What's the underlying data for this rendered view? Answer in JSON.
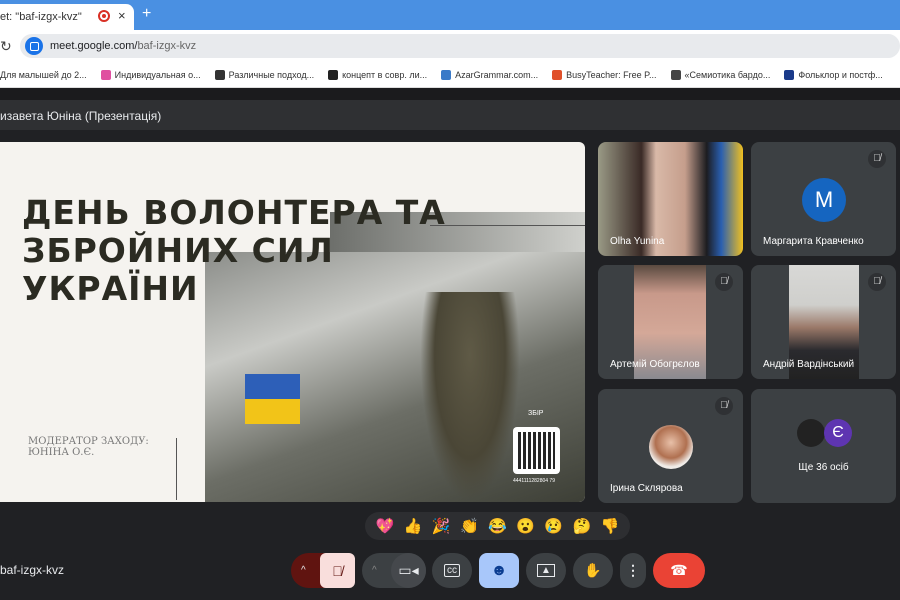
{
  "browser": {
    "tab_title": "et: \"baf-izgx-kvz\"",
    "new_tab": "+",
    "close": "×",
    "url_host": "meet.google.com/",
    "url_path": "baf-izgx-kvz",
    "bookmarks": [
      {
        "label": "Для малышей до 2...",
        "color": "#e67c22"
      },
      {
        "label": "Индивидуальная о...",
        "color": "#e04fa0"
      },
      {
        "label": "Различные подход...",
        "color": "#333333"
      },
      {
        "label": "концепт в совр. ли...",
        "color": "#222222"
      },
      {
        "label": "AzarGrammar.com...",
        "color": "#3a7ac8"
      },
      {
        "label": "BusyTeacher: Free P...",
        "color": "#e0502a"
      },
      {
        "label": "«Семиотика бардо...",
        "color": "#444444"
      },
      {
        "label": "Фольклор и постф...",
        "color": "#1a3a8a"
      }
    ]
  },
  "meet": {
    "presenter_header": "изавета Юніна (Презентація)",
    "slide": {
      "title_lines": [
        "ДЕНЬ ВОЛОНТЕРА ТА",
        "ЗБРОЙНИХ СИЛ",
        "УКРАЇНИ"
      ],
      "moderator_lines": [
        "МОДЕРАТОР ЗАХОДУ:",
        "ЮНІНА О.Є."
      ],
      "zbir": "ЗБІР",
      "qr_number": "4441111282804 79"
    },
    "participants": [
      {
        "name": "Olha Yunina",
        "muted": false
      },
      {
        "name": "Маргарита Кравченко",
        "avatar": "M",
        "avatar_color": "#1565c0",
        "muted": true
      },
      {
        "name": "Артемій Обогрєлов",
        "muted": true
      },
      {
        "name": "Андрій Вардінський",
        "muted": true
      },
      {
        "name": "Ірина Склярова",
        "muted": true
      },
      {
        "name": "Ще 36 осіб",
        "avatar": "Є",
        "avatar_color": "#5e35b1"
      }
    ],
    "reactions": [
      "💖",
      "👍",
      "🎉",
      "👏",
      "😂",
      "😮",
      "😢",
      "🤔",
      "👎"
    ],
    "meeting_code": "baf-izgx-kvz",
    "colors": {
      "end_call": "#ea4335",
      "reactions_active": "#a8c7fa",
      "mic_muted": "#f9dedc"
    }
  }
}
